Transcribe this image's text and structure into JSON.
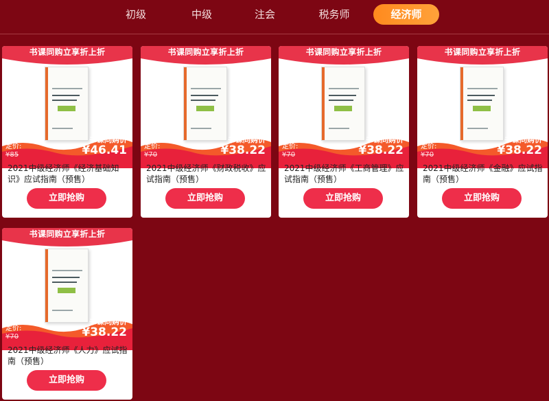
{
  "tabs": [
    {
      "label": "初级"
    },
    {
      "label": "中级"
    },
    {
      "label": "注会"
    },
    {
      "label": "税务师"
    },
    {
      "label": "经济师",
      "active": true
    }
  ],
  "products": [
    {
      "banner": "书课同购立享折上折",
      "old_label": "定价:",
      "old_price": "¥85",
      "promo_label": "书课同购价",
      "promo_price": "¥46.41",
      "title": "2021中级经济师《经济基础知识》应试指南（预售）",
      "button": "立即抢购"
    },
    {
      "banner": "书课同购立享折上折",
      "old_label": "定价:",
      "old_price": "¥70",
      "promo_label": "书课同购价",
      "promo_price": "¥38.22",
      "title": "2021中级经济师《财政税收》应试指南（预售）",
      "button": "立即抢购"
    },
    {
      "banner": "书课同购立享折上折",
      "old_label": "定价:",
      "old_price": "¥70",
      "promo_label": "书课同购价",
      "promo_price": "¥38.22",
      "title": "2021中级经济师《工商管理》应试指南（预售）",
      "button": "立即抢购"
    },
    {
      "banner": "书课同购立享折上折",
      "old_label": "定价:",
      "old_price": "¥70",
      "promo_label": "书课同购价",
      "promo_price": "¥38.22",
      "title": "2021中级经济师《金融》应试指南（预售）",
      "button": "立即抢购"
    },
    {
      "banner": "书课同购立享折上折",
      "old_label": "定价:",
      "old_price": "¥70",
      "promo_label": "书课同购价",
      "promo_price": "¥38.22",
      "title": "2021中级经济师《人力》应试指南（预售）",
      "button": "立即抢购"
    }
  ],
  "colors": {
    "background": "#7d0613",
    "accent": "#ff8a1e",
    "button": "#ee2e4a",
    "banner": "#e8344a"
  }
}
